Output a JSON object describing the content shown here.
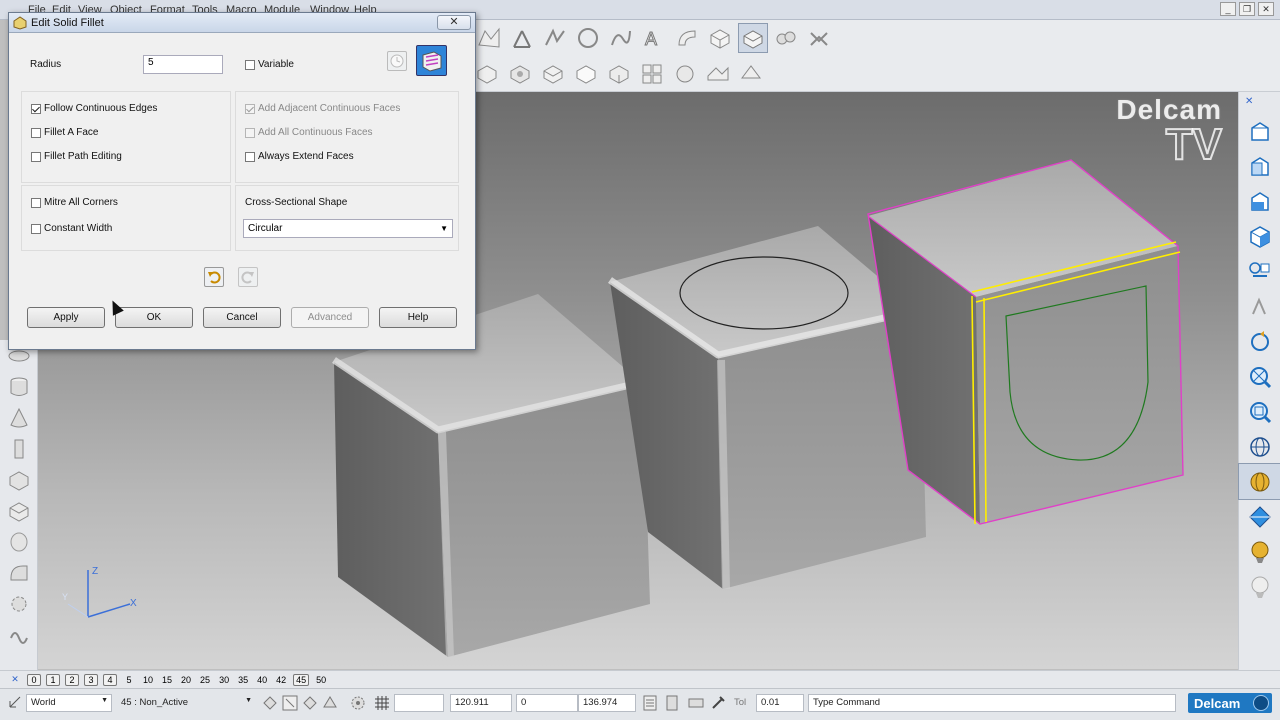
{
  "menubar": {
    "items": [
      "File",
      "Edit",
      "View",
      "Object",
      "Format",
      "Tools",
      "Macro",
      "Module",
      "Window",
      "Help"
    ]
  },
  "watermark": {
    "line1": "Delcam",
    "line2": "TV"
  },
  "dialog": {
    "title": "Edit Solid Fillet",
    "close_label": "✕",
    "radius_label": "Radius",
    "radius_value": "5",
    "variable_label": "Variable",
    "variable_checked": false,
    "options_left": [
      {
        "label": "Follow Continuous Edges",
        "checked": true,
        "enabled": true
      },
      {
        "label": "Fillet A Face",
        "checked": false,
        "enabled": true
      },
      {
        "label": "Fillet Path Editing",
        "checked": false,
        "enabled": true
      }
    ],
    "options_right": [
      {
        "label": "Add Adjacent Continuous Faces",
        "checked": true,
        "enabled": false
      },
      {
        "label": "Add All Continuous Faces",
        "checked": false,
        "enabled": false
      },
      {
        "label": "Always Extend Faces",
        "checked": false,
        "enabled": true
      }
    ],
    "corner_options": [
      {
        "label": "Mitre All Corners",
        "checked": false
      },
      {
        "label": "Constant Width",
        "checked": false
      }
    ],
    "cross_section_label": "Cross-Sectional Shape",
    "cross_section_value": "Circular",
    "buttons": {
      "apply": "Apply",
      "ok": "OK",
      "cancel": "Cancel",
      "advanced": "Advanced",
      "help": "Help"
    }
  },
  "axis": {
    "x": "X",
    "y": "Y",
    "z": "Z"
  },
  "tolerance_bar": {
    "values": [
      "0",
      "1",
      "2",
      "3",
      "4",
      "5",
      "10",
      "15",
      "20",
      "25",
      "30",
      "35",
      "40",
      "42",
      "45",
      "50"
    ],
    "boxed": [
      "0",
      "1",
      "2",
      "3",
      "4",
      "45"
    ]
  },
  "status": {
    "workplane": "World",
    "level": "45 : Non_Active",
    "x": "120.911",
    "y": "0",
    "z": "136.974",
    "tol_label": "Tol",
    "tol_value": "0.01",
    "command": "Type Command",
    "logo": "Delcam"
  },
  "colors": {
    "selected_edge": "#ffee00",
    "selected_outline": "#e040c8",
    "curve": "#1f7a1f",
    "logo": "#1f78c2"
  }
}
